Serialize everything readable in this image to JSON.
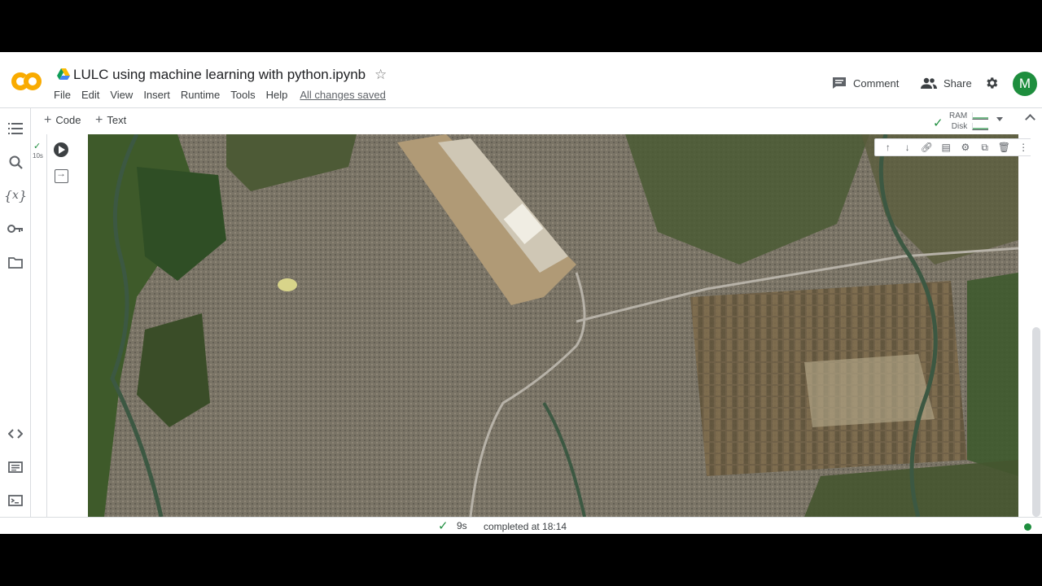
{
  "notebook": {
    "title": "LULC using machine learning with python.ipynb",
    "saved_status": "All changes saved"
  },
  "menu": [
    "File",
    "Edit",
    "View",
    "Insert",
    "Runtime",
    "Tools",
    "Help"
  ],
  "header": {
    "comment_label": "Comment",
    "share_label": "Share",
    "avatar_initial": "M"
  },
  "toolbar": {
    "code_label": "Code",
    "text_label": "Text",
    "ram_label": "RAM",
    "disk_label": "Disk"
  },
  "cell": {
    "exec_time_short": "10s"
  },
  "statusbar": {
    "duration": "9s",
    "message": "completed at 18:14"
  },
  "colors": {
    "accent": "#f9ab00",
    "success": "#1e8e3e",
    "avatar": "#1e8e3e"
  },
  "icons": {
    "rail": [
      "table-of-contents-icon",
      "search-icon",
      "variables-icon",
      "secrets-key-icon",
      "files-folder-icon",
      "code-snippets-icon",
      "command-palette-icon",
      "terminal-icon"
    ],
    "cell_toolbar": [
      "move-up-icon",
      "move-down-icon",
      "link-icon",
      "comment-icon",
      "settings-icon",
      "mirror-cell-icon",
      "delete-icon",
      "more-icon"
    ]
  }
}
